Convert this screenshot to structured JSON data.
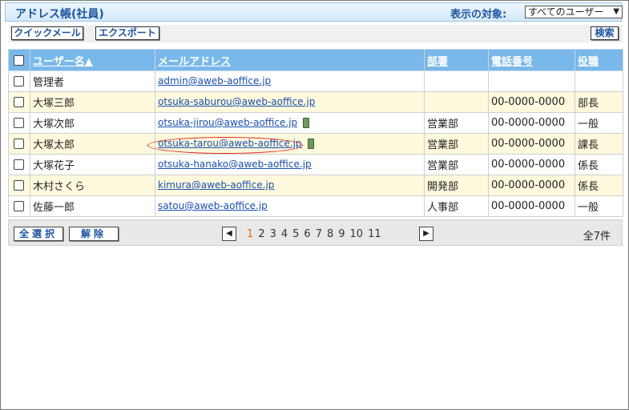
{
  "app": {
    "title": "アドレス帳(社員)"
  },
  "filter": {
    "label": "表示の対象:",
    "selected": "すべてのユーザー"
  },
  "toolbar": {
    "quick_mail": "クイックメール",
    "export": "エクスポート",
    "search": "検索"
  },
  "table": {
    "headers": {
      "user_name": "ユーザー名▲",
      "email": "メールアドレス",
      "dept": "部署",
      "phone": "電話番号",
      "title": "役職"
    },
    "rows": [
      {
        "name": "管理者",
        "email": "admin@aweb-aoffice.jp",
        "dept": "",
        "phone": "",
        "title": "",
        "mobile": false
      },
      {
        "name": "大塚三郎",
        "email": "otsuka-saburou@aweb-aoffice.jp",
        "dept": "",
        "phone": "00-0000-0000",
        "title": "部長",
        "mobile": false
      },
      {
        "name": "大塚次郎",
        "email": "otsuka-jirou@aweb-aoffice.jp",
        "dept": "営業部",
        "phone": "00-0000-0000",
        "title": "一般",
        "mobile": true
      },
      {
        "name": "大塚太郎",
        "email": "otsuka-tarou@aweb-aoffice.jp",
        "dept": "営業部",
        "phone": "00-0000-0000",
        "title": "課長",
        "mobile": true
      },
      {
        "name": "大塚花子",
        "email": "otsuka-hanako@aweb-aoffice.jp",
        "dept": "営業部",
        "phone": "00-0000-0000",
        "title": "係長",
        "mobile": false
      },
      {
        "name": "木村さくら",
        "email": "kimura@aweb-aoffice.jp",
        "dept": "開発部",
        "phone": "00-0000-0000",
        "title": "係長",
        "mobile": false
      },
      {
        "name": "佐藤一郎",
        "email": "satou@aweb-aoffice.jp",
        "dept": "人事部",
        "phone": "00-0000-0000",
        "title": "一般",
        "mobile": false
      }
    ]
  },
  "footer": {
    "select_all": "全選択",
    "deselect": "解除",
    "pages": [
      "1",
      "2",
      "3",
      "4",
      "5",
      "6",
      "7",
      "8",
      "9",
      "10",
      "11"
    ],
    "current_page": "1",
    "total": "全7件"
  }
}
